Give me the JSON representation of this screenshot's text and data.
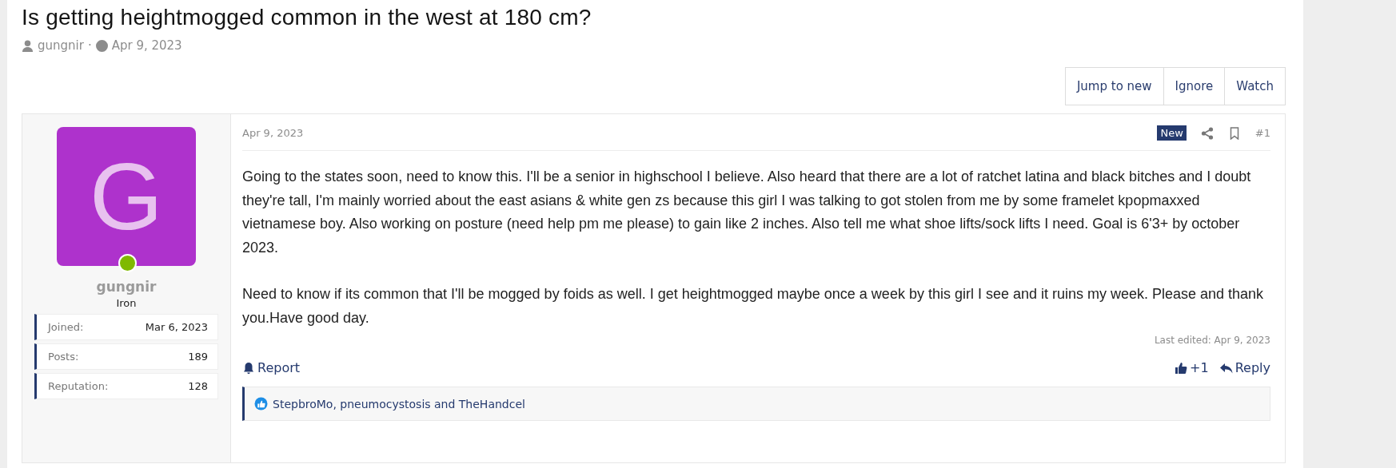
{
  "thread": {
    "title": "Is getting heightmogged common in the west at 180 cm?",
    "author": "gungnir",
    "separator": "·",
    "date": "Apr 9, 2023"
  },
  "actions": [
    "Jump to new",
    "Ignore",
    "Watch"
  ],
  "post": {
    "user": {
      "initial": "G",
      "name": "gungnir",
      "rank": "Iron",
      "online": true,
      "stats": [
        {
          "label": "Joined:",
          "value": "Mar 6, 2023"
        },
        {
          "label": "Posts:",
          "value": "189"
        },
        {
          "label": "Reputation:",
          "value": "128"
        }
      ]
    },
    "date": "Apr 9, 2023",
    "badge": "New",
    "number": "#1",
    "paragraphs": [
      "Going to the states soon, need to know this. I'll be a senior in highschool I believe. Also heard that there are a lot of ratchet latina and black bitches and I doubt they're tall, I'm mainly worried about the east asians & white gen zs because this girl I was talking to got stolen from me by some framelet kpopmaxxed vietnamese boy. Also working on posture (need help pm me please) to gain like 2 inches. Also tell me what shoe lifts/sock lifts I need. Goal is 6'3+ by october 2023.",
      "Need to know if its common that I'll be mogged by foids as well. I get heightmogged maybe once a week by this girl I see and it ruins my week. Please and thank you.Have good day."
    ],
    "last_edited": "Last edited: Apr 9, 2023",
    "report": "Report",
    "like_count": "+1",
    "reply": "Reply",
    "reactions": "StepbroMo, pneumocystosis and TheHandcel"
  }
}
